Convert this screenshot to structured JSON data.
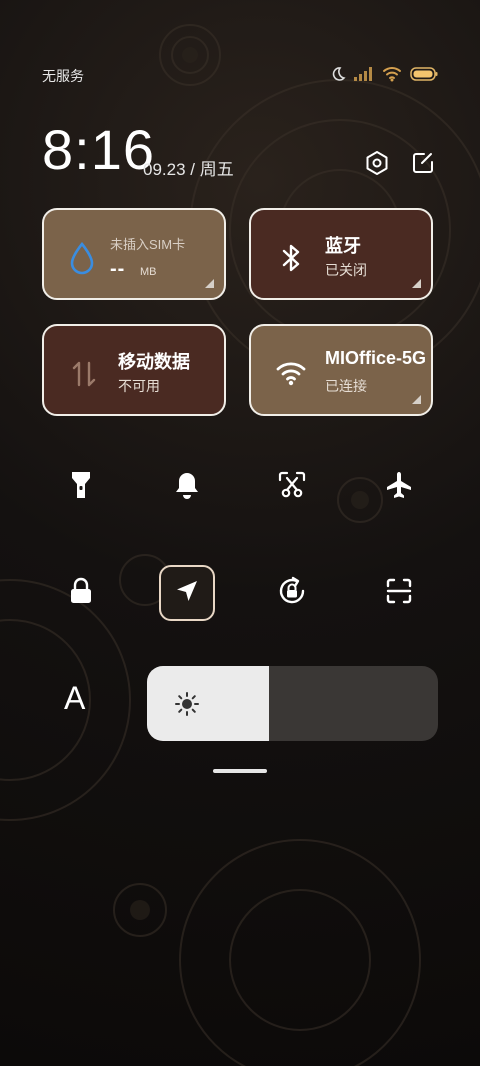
{
  "status_bar": {
    "carrier": "无服务",
    "icons": [
      "moon-icon",
      "signal-icon",
      "wifi-icon",
      "battery-icon"
    ]
  },
  "header": {
    "time": "8:16",
    "date": "09.23",
    "separator": "/",
    "weekday": "周五",
    "buttons": [
      "settings-icon",
      "edit-icon"
    ]
  },
  "tiles": {
    "sim": {
      "title": "未插入SIM卡",
      "value": "--",
      "unit": "MB",
      "icon": "water-drop-icon"
    },
    "bluetooth": {
      "title": "蓝牙",
      "status": "已关闭",
      "icon": "bluetooth-icon"
    },
    "mobile_data": {
      "title": "移动数据",
      "status": "不可用",
      "icon": "data-arrows-icon"
    },
    "wifi": {
      "title": "MIOffice-5G",
      "status": "已连接",
      "icon": "wifi-icon"
    }
  },
  "quick_toggles": [
    {
      "icon": "flashlight-icon",
      "active": false
    },
    {
      "icon": "bell-icon",
      "active": false
    },
    {
      "icon": "screenshot-scissors-icon",
      "active": false
    },
    {
      "icon": "airplane-icon",
      "active": false
    },
    {
      "icon": "lock-icon",
      "active": false
    },
    {
      "icon": "location-icon",
      "active": true
    },
    {
      "icon": "rotation-lock-icon",
      "active": false
    },
    {
      "icon": "scan-icon",
      "active": false
    }
  ],
  "font_label": "A",
  "brightness": {
    "level": 0.42,
    "icon": "sun-icon"
  },
  "colors": {
    "tile_gold": "#7b634a",
    "tile_brown": "#4a2a22",
    "tile_border": "#f1eee8",
    "slider_fill": "#ebebeb",
    "slider_track": "#3a3735"
  }
}
